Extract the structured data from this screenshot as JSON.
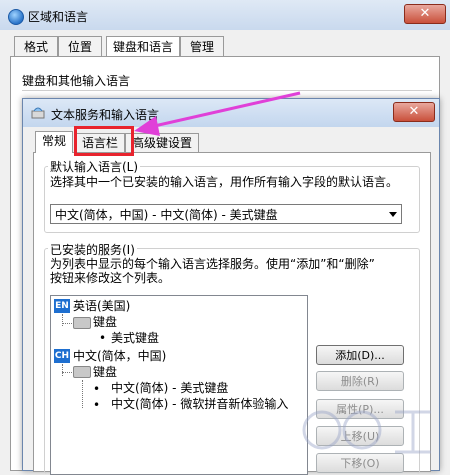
{
  "outer_window": {
    "title": "区域和语言",
    "close_label": "✕",
    "tabs": [
      "格式",
      "位置",
      "键盘和语言",
      "管理"
    ],
    "group_label": "键盘和其他输入语言"
  },
  "inner_window": {
    "title": "文本服务和输入语言",
    "close_label": "✕",
    "tabs": [
      "常规",
      "语言栏",
      "高级键设置"
    ],
    "default_group": {
      "label": "默认输入语言(L)",
      "description": "选择其中一个已安装的输入语言，用作所有输入字段的默认语言。",
      "selected_value": "中文(简体，中国) - 中文(简体) - 美式键盘"
    },
    "installed_group": {
      "label": "已安装的服务(I)",
      "description_line1": "为列表中显示的每个输入语言选择服务。使用“添加”和“删除”",
      "description_line2": "按钮来修改这个列表。",
      "tree": {
        "lang1_badge": "EN",
        "lang1_label": "英语(美国)",
        "lang1_keyboard": "键盘",
        "lang1_item1": "美式键盘",
        "lang2_badge": "CH",
        "lang2_label": "中文(简体，中国)",
        "lang2_keyboard": "键盘",
        "lang2_item1": "中文(简体) - 美式键盘",
        "lang2_item2": "中文(简体) - 微软拼音新体验输入"
      },
      "buttons": {
        "add": "添加(D)...",
        "remove": "删除(R)",
        "properties": "属性(P)...",
        "move_up": "上移(U)",
        "move_down": "下移(O)"
      }
    }
  },
  "annotation": {
    "highlight_color": "#e8232d",
    "arrow_color": "#e040d8"
  }
}
